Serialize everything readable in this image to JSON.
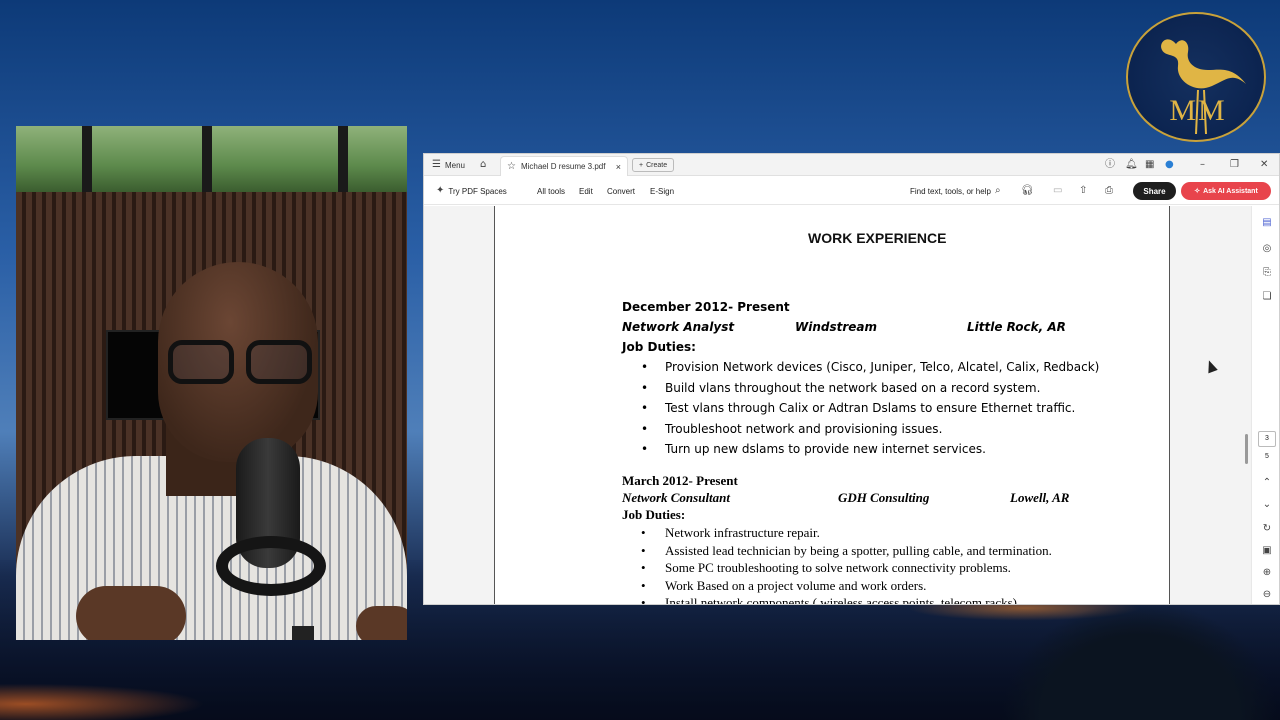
{
  "logo": {
    "text": "MM"
  },
  "titlebar": {
    "menu_label": "Menu",
    "tab_title": "Michael D resume 3.pdf",
    "tab_close": "×",
    "create_label": "Create"
  },
  "toolbar": {
    "try_spaces": "Try PDF Spaces",
    "all_tools": "All tools",
    "edit": "Edit",
    "convert": "Convert",
    "esign": "E-Sign",
    "search_placeholder": "Find text, tools, or help",
    "share": "Share",
    "ai_assistant": "Ask AI Assistant"
  },
  "document": {
    "section_title": "WORK EXPERIENCE",
    "job1": {
      "dates": "December 2012- Present",
      "title": "Network Analyst",
      "company": "Windstream",
      "location": "Little Rock, AR",
      "duties_label": "Job Duties:",
      "duties": [
        "Provision Network devices (Cisco, Juniper, Telco, Alcatel, Calix, Redback)",
        "Build vlans throughout the network based on a record system.",
        "Test vlans through Calix or Adtran Dslams to ensure Ethernet traffic.",
        "Troubleshoot network and provisioning issues.",
        "Turn up new dslams to provide new internet services."
      ]
    },
    "job2": {
      "dates": "March 2012- Present",
      "title": "Network Consultant",
      "company": "GDH Consulting",
      "location": "Lowell, AR",
      "duties_label": "Job Duties:",
      "duties": [
        "Network infrastructure repair.",
        "Assisted lead technician by being a spotter, pulling cable, and termination.",
        "Some PC troubleshooting to solve network connectivity problems.",
        "Work Based on a project volume and work orders.",
        "Install network components ( wireless access points, telecom racks)"
      ]
    }
  },
  "page_nav": {
    "current": "3",
    "total": "5"
  },
  "icons": [
    "menu-icon",
    "home-icon",
    "star-icon",
    "plus-icon",
    "help-icon",
    "bell-icon",
    "apps-icon",
    "profile-icon",
    "minimize-icon",
    "maximize-icon",
    "close-icon",
    "spaces-icon",
    "search-icon",
    "headphones-icon",
    "save-icon",
    "upload-icon",
    "print-icon",
    "ai-icon",
    "comment-icon",
    "bookmark-icon",
    "copy-icon",
    "chevron-up-icon",
    "chevron-down-icon",
    "refresh-icon",
    "page-icon",
    "zoom-in-icon",
    "zoom-out-icon"
  ],
  "colors": {
    "ai_button": "#e8444c",
    "share_button": "#1e1e1e",
    "logo_gold": "#e0b545"
  }
}
